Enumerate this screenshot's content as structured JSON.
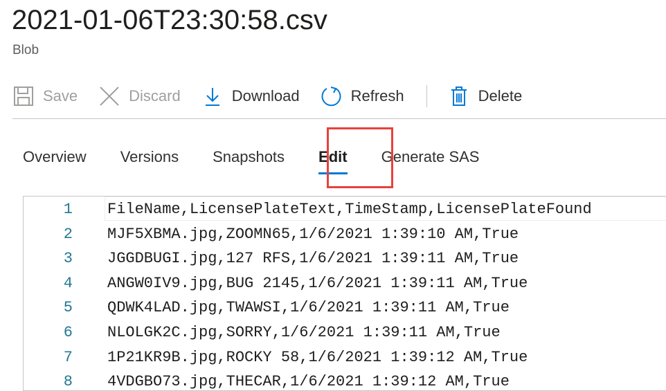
{
  "header": {
    "title": "2021-01-06T23:30:58.csv",
    "subtitle": "Blob"
  },
  "toolbar": {
    "save": "Save",
    "discard": "Discard",
    "download": "Download",
    "refresh": "Refresh",
    "delete": "Delete"
  },
  "tabs": [
    {
      "label": "Overview"
    },
    {
      "label": "Versions"
    },
    {
      "label": "Snapshots"
    },
    {
      "label": "Edit"
    },
    {
      "label": "Generate SAS"
    }
  ],
  "active_tab": "Edit",
  "editor": {
    "lines": [
      {
        "num": "1",
        "text": "FileName,LicensePlateText,TimeStamp,LicensePlateFound"
      },
      {
        "num": "2",
        "text": "MJF5XBMA.jpg,ZOOMN65,1/6/2021 1:39:10 AM,True"
      },
      {
        "num": "3",
        "text": "JGGDBUGI.jpg,127 RFS,1/6/2021 1:39:11 AM,True"
      },
      {
        "num": "4",
        "text": "ANGW0IV9.jpg,BUG 2145,1/6/2021 1:39:11 AM,True"
      },
      {
        "num": "5",
        "text": "QDWK4LAD.jpg,TWAWSI,1/6/2021 1:39:11 AM,True"
      },
      {
        "num": "6",
        "text": "NLOLGK2C.jpg,SORRY,1/6/2021 1:39:11 AM,True"
      },
      {
        "num": "7",
        "text": "1P21KR9B.jpg,ROCKY 58,1/6/2021 1:39:12 AM,True"
      },
      {
        "num": "8",
        "text": "4VDGBO73.jpg,THECAR,1/6/2021 1:39:12 AM,True"
      }
    ]
  },
  "colors": {
    "accent": "#0078d4",
    "highlight_box": "#e8403c",
    "line_number": "#237893"
  },
  "icons": {
    "save": "save-icon",
    "discard": "close-icon",
    "download": "download-icon",
    "refresh": "refresh-icon",
    "delete": "trash-icon"
  }
}
